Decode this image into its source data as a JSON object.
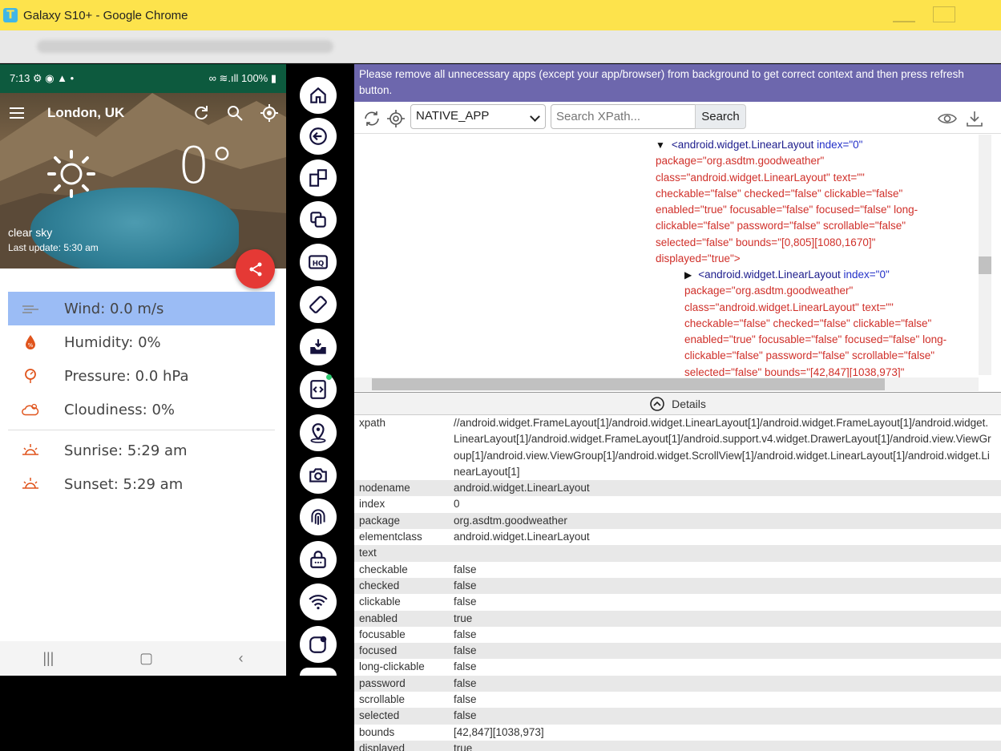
{
  "window": {
    "title": "Galaxy S10+ - Google Chrome",
    "logo_letter": "T"
  },
  "phone": {
    "status": {
      "time": "7:13",
      "battery": "100%"
    },
    "city": "London, UK",
    "temperature": "0°",
    "description": "clear sky",
    "last_update": "Last update: 5:30 am",
    "rows": [
      {
        "label": "Wind: 0.0 m/s",
        "icon": "wind-icon",
        "selected": true
      },
      {
        "label": "Humidity: 0%",
        "icon": "humidity-icon"
      },
      {
        "label": "Pressure: 0.0 hPa",
        "icon": "pressure-icon"
      },
      {
        "label": "Cloudiness: 0%",
        "icon": "cloudiness-icon"
      },
      {
        "label": "Sunrise: 5:29 am",
        "icon": "sunrise-icon"
      },
      {
        "label": "Sunset: 5:29 am",
        "icon": "sunset-icon"
      }
    ],
    "nav": {
      "recents": "|||",
      "home": "▢",
      "back": "‹"
    }
  },
  "inspector": {
    "notice": "Please remove all unnecessary apps (except your app/browser) from background to get correct context and then press refresh button.",
    "context": "NATIVE_APP",
    "search_placeholder": "Search XPath...",
    "search_label": "Search",
    "details_label": "Details",
    "tree": {
      "node1": {
        "tag": "<android.widget.LinearLayout",
        "lines": [
          "index=\"0\"",
          "package=\"org.asdtm.goodweather\"",
          "class=\"android.widget.LinearLayout\" text=\"\"",
          "checkable=\"false\" checked=\"false\" clickable=\"false\"",
          "enabled=\"true\" focusable=\"false\" focused=\"false\" long-",
          "clickable=\"false\" password=\"false\" scrollable=\"false\"",
          "selected=\"false\" bounds=\"[0,805][1080,1670]\"",
          "displayed=\"true\">"
        ]
      },
      "node2": {
        "tag": "<android.widget.LinearLayout",
        "lines": [
          "index=\"0\"",
          "package=\"org.asdtm.goodweather\"",
          "class=\"android.widget.LinearLayout\" text=\"\"",
          "checkable=\"false\" checked=\"false\" clickable=\"false\"",
          "enabled=\"true\" focusable=\"false\" focused=\"false\" long-",
          "clickable=\"false\" password=\"false\" scrollable=\"false\"",
          "selected=\"false\" bounds=\"[42,847][1038,973]\""
        ]
      }
    },
    "details": [
      {
        "key": "xpath",
        "value": "//android.widget.FrameLayout[1]/android.widget.LinearLayout[1]/android.widget.FrameLayout[1]/android.widget.LinearLayout[1]/android.widget.FrameLayout[1]/android.support.v4.widget.DrawerLayout[1]/android.view.ViewGroup[1]/android.view.ViewGroup[1]/android.widget.ScrollView[1]/android.widget.LinearLayout[1]/android.widget.LinearLayout[1]"
      },
      {
        "key": "nodename",
        "value": "android.widget.LinearLayout"
      },
      {
        "key": "index",
        "value": "0"
      },
      {
        "key": "package",
        "value": "org.asdtm.goodweather"
      },
      {
        "key": "elementclass",
        "value": "android.widget.LinearLayout"
      },
      {
        "key": "text",
        "value": ""
      },
      {
        "key": "checkable",
        "value": "false"
      },
      {
        "key": "checked",
        "value": "false"
      },
      {
        "key": "clickable",
        "value": "false"
      },
      {
        "key": "enabled",
        "value": "true"
      },
      {
        "key": "focusable",
        "value": "false"
      },
      {
        "key": "focused",
        "value": "false"
      },
      {
        "key": "long-clickable",
        "value": "false"
      },
      {
        "key": "password",
        "value": "false"
      },
      {
        "key": "scrollable",
        "value": "false"
      },
      {
        "key": "selected",
        "value": "false"
      },
      {
        "key": "bounds",
        "value": "[42,847][1038,973]"
      },
      {
        "key": "displayed",
        "value": "true"
      }
    ]
  },
  "toolbar_icons": [
    "home-icon",
    "back-icon",
    "app-switch-icon",
    "copy-icon",
    "hq-icon",
    "rotate-icon",
    "inbox-icon",
    "inspect-code-icon",
    "location-icon",
    "camera-icon",
    "fingerprint-icon",
    "lock-icon",
    "wifi-icon",
    "notification-icon"
  ],
  "colors": {
    "titlebar": "#fde34c",
    "notice": "#6d67ad",
    "fab": "#e53935",
    "selected_row": "#9bbcf5",
    "status_bar": "#0d5a3e"
  }
}
